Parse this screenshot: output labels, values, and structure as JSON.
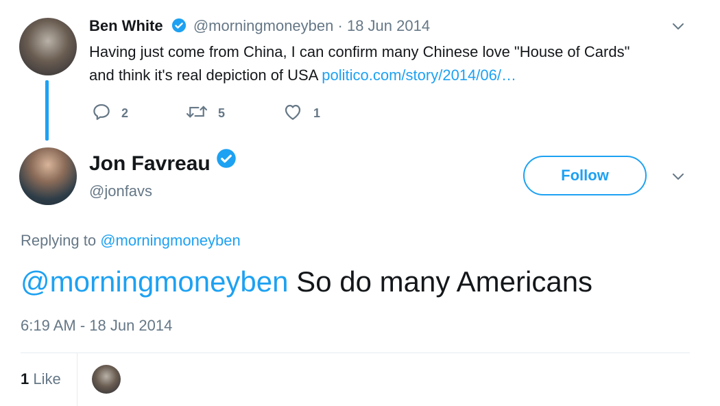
{
  "parent_tweet": {
    "name": "Ben White",
    "handle": "@morningmoneyben",
    "separator": "·",
    "date": "18 Jun 2014",
    "text": "Having just come from China, I can confirm many Chinese love \"House of Cards\" and think it's real depiction of USA ",
    "link": "politico.com/story/2014/06/…",
    "replies": "2",
    "retweets": "5",
    "likes": "1",
    "verified": true
  },
  "main_tweet": {
    "name": "Jon Favreau",
    "handle": "@jonfavs",
    "verified": true,
    "follow_label": "Follow",
    "replying_prefix": "Replying to",
    "replying_to": "@morningmoneyben",
    "mention": "@morningmoneyben",
    "body": " So do many Americans",
    "timestamp": "6:19 AM - 18 Jun 2014",
    "like_count": "1",
    "like_label": "Like"
  },
  "icons": {
    "verified": "verified-badge-icon",
    "caret": "chevron-down-icon",
    "reply": "reply-icon",
    "retweet": "retweet-icon",
    "like": "heart-icon"
  },
  "colors": {
    "accent": "#1da1f2",
    "text": "#14171a",
    "muted": "#657786"
  }
}
